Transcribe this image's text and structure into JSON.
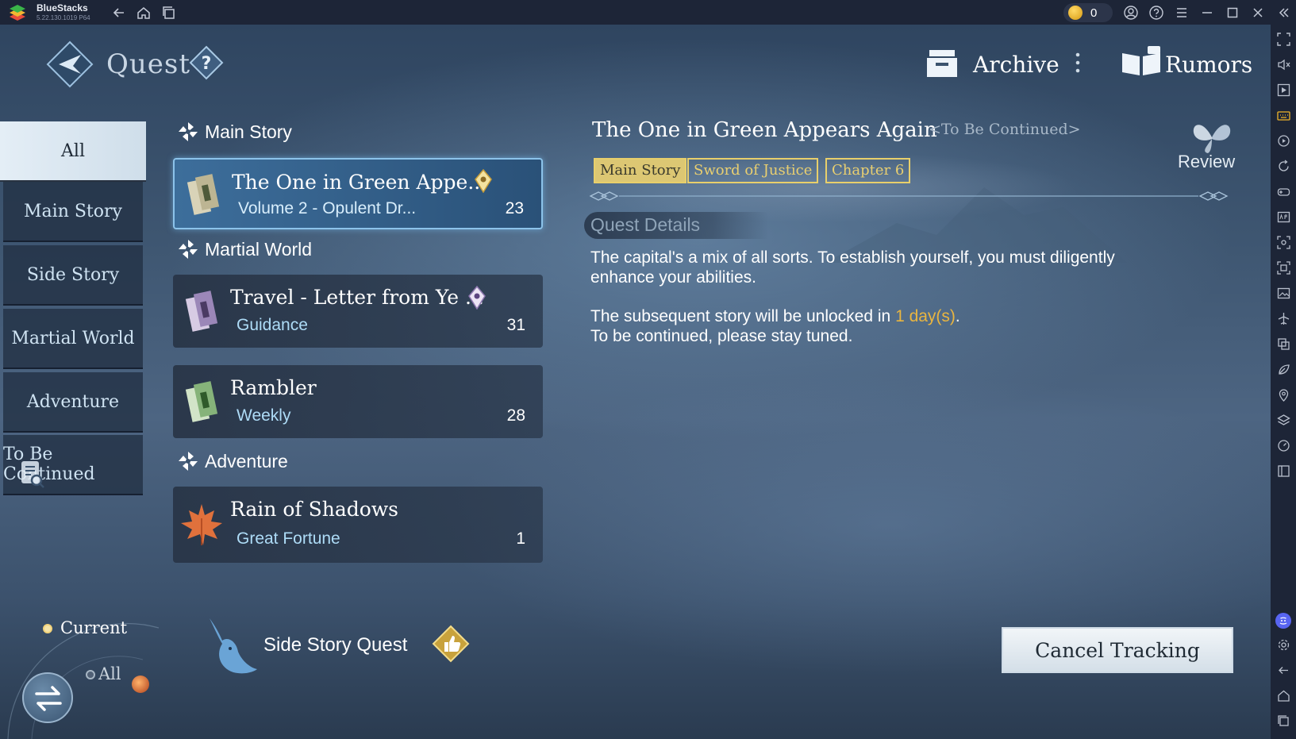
{
  "titlebar": {
    "app_name": "BlueStacks",
    "version": "5.22.130.1019  P64",
    "coins": "0"
  },
  "header": {
    "title": "Quest",
    "archive_label": "Archive",
    "rumors_label": "Rumors"
  },
  "categories": [
    {
      "label": "All",
      "active": true
    },
    {
      "label": "Main Story",
      "active": false
    },
    {
      "label": "Side Story",
      "active": false
    },
    {
      "label": "Martial World",
      "active": false
    },
    {
      "label": "Adventure",
      "active": false
    },
    {
      "label": "To Be Continued",
      "active": false
    }
  ],
  "groups": [
    {
      "name": "Main Story"
    },
    {
      "name": "Martial World"
    },
    {
      "name": "Adventure"
    }
  ],
  "quests": [
    {
      "title": "The One in Green Appe...",
      "subtitle": "Volume 2 - Opulent Dr...",
      "count": "23",
      "selected": true
    },
    {
      "title": "Travel - Letter from Ye ...",
      "subtitle": "Guidance",
      "count": "31",
      "selected": false
    },
    {
      "title": "Rambler",
      "subtitle": "Weekly",
      "count": "28",
      "selected": false
    },
    {
      "title": "Rain of Shadows",
      "subtitle": "Great Fortune",
      "count": "1",
      "selected": false
    }
  ],
  "detail": {
    "title": "The One in Green Appears Again",
    "status": "<To Be Continued>",
    "tags": [
      "Main Story",
      "Sword of Justice",
      "Chapter 6"
    ],
    "review_label": "Review",
    "section_title": "Quest Details",
    "desc_1": "The capital's a mix of all sorts. To establish yourself, you must diligently enhance your abilities.",
    "desc_2_prefix": "The subsequent story will be unlocked in ",
    "desc_2_highlight": "1 day(s)",
    "desc_2_suffix": ".",
    "desc_3": "To be continued, please stay tuned."
  },
  "bottom": {
    "current_label": "Current",
    "all_label": "All",
    "side_story_label": "Side Story Quest",
    "cancel_label": "Cancel Tracking"
  },
  "colors": {
    "highlight": "#e9b540",
    "tag_border": "#e8cf6b",
    "selected_card": "#3d6e9b"
  }
}
